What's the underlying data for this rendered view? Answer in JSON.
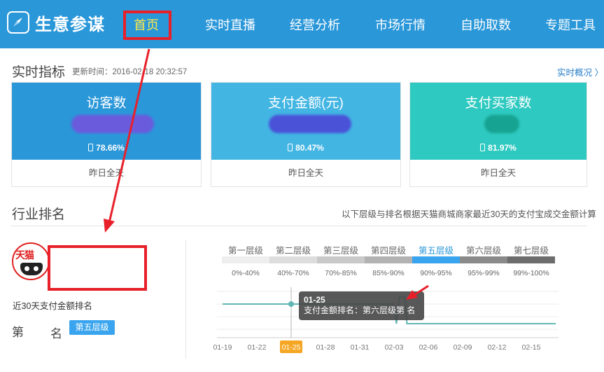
{
  "brand": {
    "name": "生意参谋",
    "icon": "compass-icon"
  },
  "nav": {
    "items": [
      {
        "label": "首页",
        "active": true
      },
      {
        "label": "实时直播",
        "active": false
      },
      {
        "label": "经营分析",
        "active": false
      },
      {
        "label": "市场行情",
        "active": false
      },
      {
        "label": "自助取数",
        "active": false
      },
      {
        "label": "专题工具",
        "active": false
      }
    ]
  },
  "realtime": {
    "title": "实时指标",
    "update_time": "更新时间：2016-02-18 20:32:57",
    "overview_link": "实时概况 〉"
  },
  "cards": [
    {
      "title": "访客数",
      "mobile_pct": "78.66%",
      "footer": "昨日全天",
      "color": "#2a97d9",
      "icon": "mobile-icon"
    },
    {
      "title": "支付金额(元)",
      "mobile_pct": "80.47%",
      "footer": "昨日全天",
      "color": "#42b5e3",
      "icon": "mobile-icon"
    },
    {
      "title": "支付买家数",
      "mobile_pct": "81.97%",
      "footer": "昨日全天",
      "color": "#2ec9c0",
      "icon": "mobile-icon"
    }
  ],
  "ranking": {
    "title": "行业排名",
    "note": "以下层级与排名根据天猫商城商家最近30天的支付宝成交金额计算",
    "logo_text": "天猫",
    "label": "近30天支付金额排名",
    "rank_prefix": "第",
    "rank_suffix": "名",
    "tier_badge": "第五层级",
    "active_tier": 4,
    "tiers": [
      {
        "name": "第一层级",
        "range": "0%-40%",
        "color": "#eeeeee"
      },
      {
        "name": "第二层级",
        "range": "40%-70%",
        "color": "#dddddd"
      },
      {
        "name": "第三层级",
        "range": "70%-85%",
        "color": "#c9c9c9"
      },
      {
        "name": "第四层级",
        "range": "85%-90%",
        "color": "#b2b2b2"
      },
      {
        "name": "第五层级",
        "range": "90%-95%",
        "color": "#3aa5ee"
      },
      {
        "name": "第六层级",
        "range": "95%-99%",
        "color": "#8a8a8a"
      },
      {
        "name": "第七层级",
        "range": "99%-100%",
        "color": "#6d6d6d"
      }
    ]
  },
  "tooltip": {
    "date": "01-25",
    "text": "支付金额排名：第六层级第  名"
  },
  "chart_data": {
    "type": "line",
    "x": [
      "01-19",
      "01-22",
      "01-25",
      "01-28",
      "01-31",
      "02-03",
      "02-06",
      "02-09",
      "02-12",
      "02-15"
    ],
    "highlight": "01-25",
    "line_color": "#5fb7b3"
  }
}
